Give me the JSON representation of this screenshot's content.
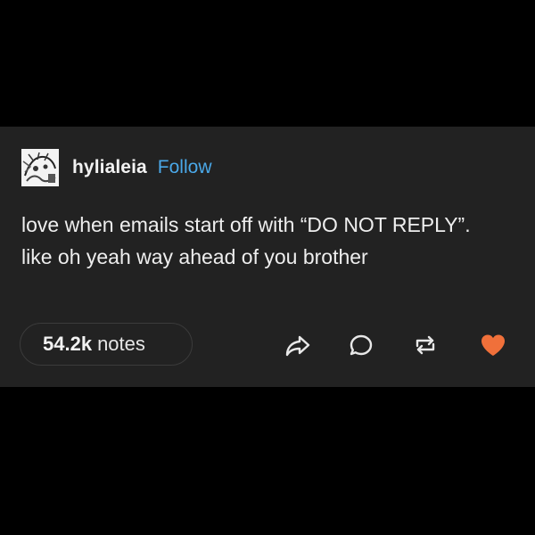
{
  "post": {
    "username": "hylialeia",
    "follow_label": "Follow",
    "text": "love when emails start off with “DO NOT REPLY”. like oh yeah way ahead of you brother",
    "notes_count": "54.2k",
    "notes_label": "notes"
  },
  "icons": {
    "avatar": "avatar-image",
    "share": "share-icon",
    "reply": "reply-icon",
    "reblog": "reblog-icon",
    "like": "heart-icon"
  },
  "colors": {
    "background": "#000000",
    "card": "#222222",
    "text": "#eeeeee",
    "follow": "#4aa8e8",
    "like": "#f0703a",
    "notes_border": "#3b3b3b"
  }
}
